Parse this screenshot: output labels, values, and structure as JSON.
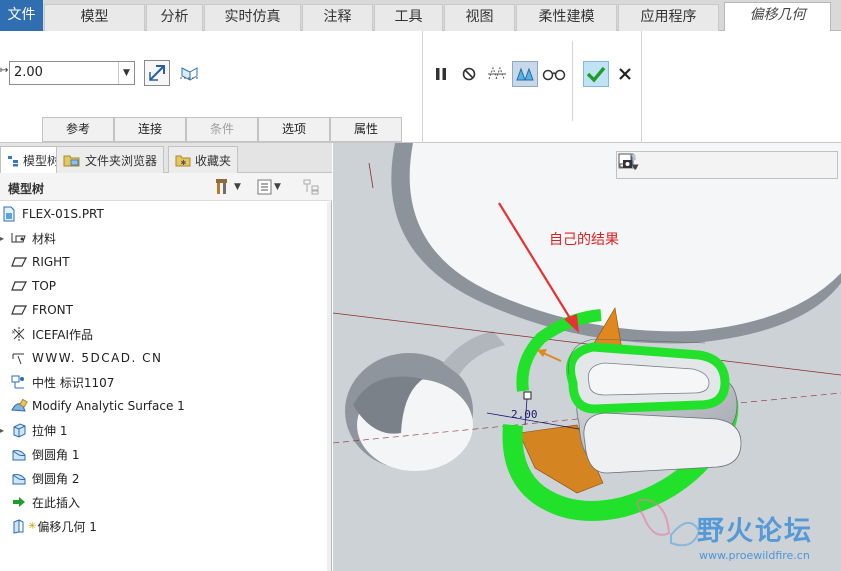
{
  "ribbon_tabs": [
    "文件",
    "模型",
    "分析",
    "实时仿真",
    "注释",
    "工具",
    "视图",
    "柔性建模",
    "应用程序",
    "偏移几何"
  ],
  "ribbon": {
    "dim_label": "↦",
    "offset_value": "2.00",
    "subtabs": [
      "参考",
      "连接",
      "条件",
      "选项",
      "属性"
    ]
  },
  "panel": {
    "tabs": [
      "模型树",
      "文件夹浏览器",
      "收藏夹"
    ],
    "title": "模型树",
    "tree": [
      {
        "label": "FLEX-01S.PRT",
        "icon": "part-icon"
      },
      {
        "label": "材料",
        "icon": "material-icon"
      },
      {
        "label": "RIGHT",
        "icon": "datum-plane-icon"
      },
      {
        "label": "TOP",
        "icon": "datum-plane-icon"
      },
      {
        "label": "FRONT",
        "icon": "datum-plane-icon"
      },
      {
        "label": "ICEFAI作品",
        "icon": "csys-icon"
      },
      {
        "label": "WWW. 5DCAD. CN",
        "icon": "note-icon"
      },
      {
        "label": "中性 标识1107",
        "icon": "tag-icon"
      },
      {
        "label": "Modify Analytic Surface 1",
        "icon": "surface-icon"
      },
      {
        "label": "拉伸 1",
        "icon": "extrude-icon"
      },
      {
        "label": "倒圆角 1",
        "icon": "round-icon"
      },
      {
        "label": "倒圆角 2",
        "icon": "round-icon"
      },
      {
        "label": "在此插入",
        "icon": "insert-arrow-icon"
      },
      {
        "label": "偏移几何 1",
        "icon": "offset-geometry-icon"
      }
    ]
  },
  "viewport": {
    "annotation": "自己的结果",
    "dimension": "2.00",
    "watermark_title": "野火论坛",
    "watermark_url": "www.proewildfire.cn"
  },
  "colors": {
    "file_tab": "#2f6eb0",
    "highlight_green": "#22e12a",
    "offset_orange": "#e0871e",
    "annotation_red": "#e02020"
  }
}
